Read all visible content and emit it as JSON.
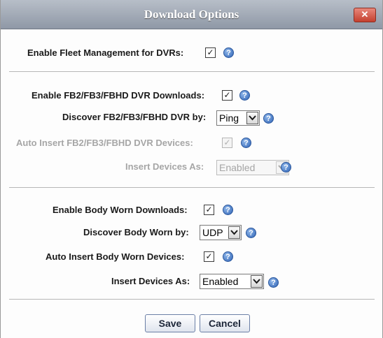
{
  "dialog": {
    "title": "Download Options",
    "close_glyph": "✕"
  },
  "fleet": {
    "enable_label": "Enable Fleet Management for DVRs:",
    "enable_checked": true
  },
  "fb": {
    "enable_label": "Enable FB2/FB3/FBHD DVR Downloads:",
    "enable_checked": true,
    "discover_label": "Discover FB2/FB3/FBHD DVR by:",
    "discover_value": "Ping",
    "auto_insert_label": "Auto Insert FB2/FB3/FBHD DVR Devices:",
    "auto_insert_checked": true,
    "insert_as_label": "Insert Devices As:",
    "insert_as_value": "Enabled"
  },
  "body_worn": {
    "enable_label": "Enable Body Worn Downloads:",
    "enable_checked": true,
    "discover_label": "Discover Body Worn by:",
    "discover_value": "UDP",
    "auto_insert_label": "Auto Insert Body Worn Devices:",
    "auto_insert_checked": true,
    "insert_as_label": "Insert Devices As:",
    "insert_as_value": "Enabled"
  },
  "buttons": {
    "save": "Save",
    "cancel": "Cancel"
  },
  "icons": {
    "help": "help-icon",
    "help_glyph": "?",
    "check_glyph": "✓"
  },
  "colors": {
    "titlebar": "#9ea6b2",
    "help_blue": "#2f63b5",
    "close_red": "#c4402f"
  }
}
